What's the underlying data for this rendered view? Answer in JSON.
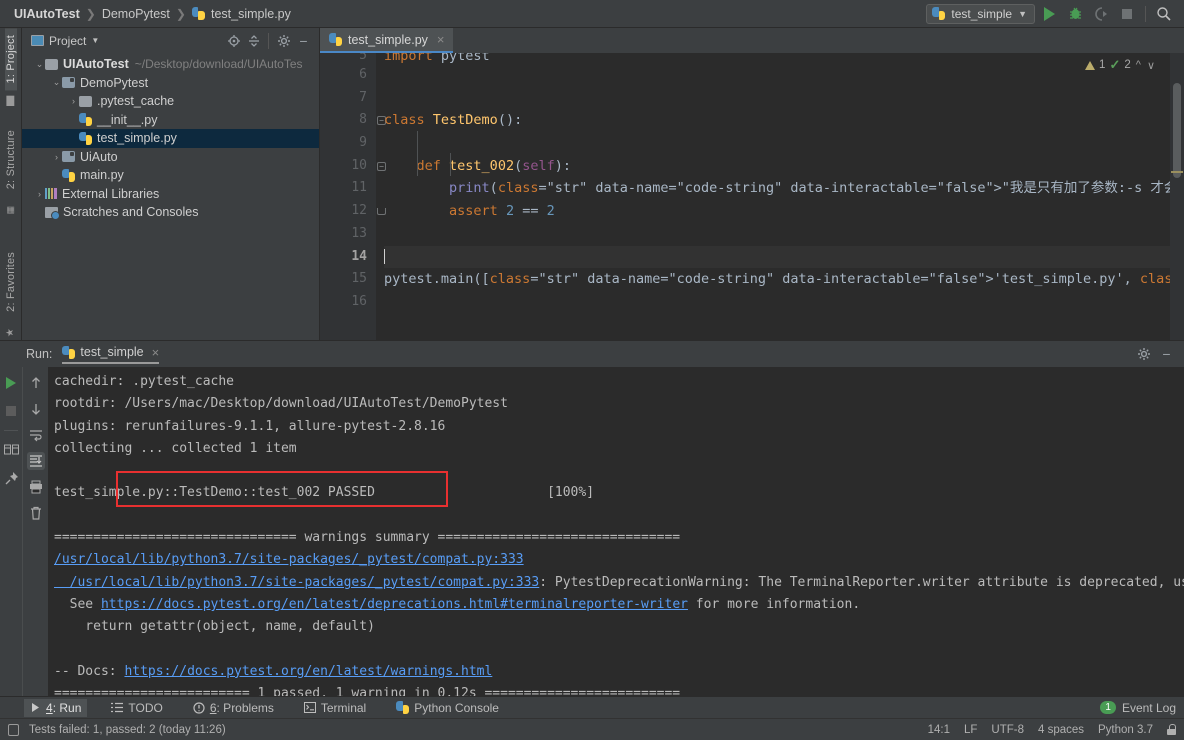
{
  "topbar": {
    "breadcrumbs": [
      "UIAutoTest",
      "DemoPytest",
      "test_simple.py"
    ],
    "run_config": "test_simple",
    "icons": [
      "run-icon",
      "debug-icon",
      "coverage-icon",
      "stop-icon",
      "search-icon"
    ]
  },
  "left_strip": {
    "tabs": [
      "1: Project",
      "2: Structure"
    ],
    "bottom_tabs": [
      "2: Favorites"
    ]
  },
  "project_panel": {
    "title": "Project",
    "header_icons": [
      "locate-icon",
      "collapse-all-icon",
      "gear-icon",
      "minimize-icon"
    ],
    "tree": [
      {
        "label": "UIAutoTest",
        "path": "~/Desktop/download/UIAutoTes",
        "depth": 0,
        "arrow": "⌄",
        "kind": "folder",
        "bold": true,
        "selected": false
      },
      {
        "label": "DemoPytest",
        "path": "",
        "depth": 1,
        "arrow": "⌄",
        "kind": "module",
        "bold": false,
        "selected": false
      },
      {
        "label": ".pytest_cache",
        "path": "",
        "depth": 2,
        "arrow": "›",
        "kind": "folder",
        "bold": false,
        "selected": false
      },
      {
        "label": "__init__.py",
        "path": "",
        "depth": 2,
        "arrow": "",
        "kind": "python",
        "bold": false,
        "selected": false
      },
      {
        "label": "test_simple.py",
        "path": "",
        "depth": 2,
        "arrow": "",
        "kind": "python",
        "bold": false,
        "selected": true
      },
      {
        "label": "UiAuto",
        "path": "",
        "depth": 1,
        "arrow": "›",
        "kind": "module",
        "bold": false,
        "selected": false
      },
      {
        "label": "main.py",
        "path": "",
        "depth": 1,
        "arrow": "",
        "kind": "python",
        "bold": false,
        "selected": false
      },
      {
        "label": "External Libraries",
        "path": "",
        "depth": 0,
        "arrow": "›",
        "kind": "library",
        "bold": false,
        "selected": false
      },
      {
        "label": "Scratches and Consoles",
        "path": "",
        "depth": 0,
        "arrow": "",
        "kind": "scratch",
        "bold": false,
        "selected": false
      }
    ]
  },
  "editor": {
    "tab_label": "test_simple.py",
    "inspection": {
      "warning_count": "1",
      "ok_count": "2"
    },
    "first_line_number": 5,
    "current_line": 14,
    "lines": [
      {
        "n": 5,
        "text": "import pytest",
        "clipped": true
      },
      {
        "n": 6,
        "text": ""
      },
      {
        "n": 7,
        "text": ""
      },
      {
        "n": 8,
        "text": "class TestDemo():",
        "fold": "open"
      },
      {
        "n": 9,
        "text": ""
      },
      {
        "n": 10,
        "text": "    def test_002(self):",
        "fold": "open"
      },
      {
        "n": 11,
        "text": "        print(\"我是只有加了参数:-s 才会显示出来\")"
      },
      {
        "n": 12,
        "text": "        assert 2 == 2",
        "fold": "end"
      },
      {
        "n": 13,
        "text": ""
      },
      {
        "n": 14,
        "text": ""
      },
      {
        "n": 15,
        "text": "pytest.main(['test_simple.py', '-v'])"
      },
      {
        "n": 16,
        "text": ""
      }
    ]
  },
  "run_panel": {
    "label": "Run:",
    "tab": "test_simple",
    "header_icons": [
      "gear-icon",
      "minimize-icon"
    ],
    "toolbar_left": [
      "rerun-icon",
      "stop-icon",
      "layout-icon",
      "pin-icon"
    ],
    "toolbar_right": [
      "up-icon",
      "down-icon",
      "soft-wrap-icon",
      "scroll-to-end-icon",
      "print-icon",
      "clear-all-icon"
    ],
    "console": [
      {
        "segs": [
          {
            "t": "cachedir: .pytest_cache"
          }
        ]
      },
      {
        "segs": [
          {
            "t": "rootdir: /Users/mac/Desktop/download/UIAutoTest/DemoPytest"
          }
        ]
      },
      {
        "segs": [
          {
            "t": "plugins: rerunfailures-9.1.1, allure-pytest-2.8.16"
          }
        ]
      },
      {
        "segs": [
          {
            "t": "collecting ... collected 1 item"
          }
        ]
      },
      {
        "segs": [
          {
            "t": ""
          }
        ]
      },
      {
        "segs": [
          {
            "t": "test_simple.py::TestDemo::test_002 PASSED                      [100%]"
          }
        ]
      },
      {
        "segs": [
          {
            "t": ""
          }
        ]
      },
      {
        "segs": [
          {
            "t": "=============================== warnings summary ==============================="
          }
        ]
      },
      {
        "segs": [
          {
            "t": "/usr/local/lib/python3.7/site-packages/_pytest/compat.py:333",
            "link": true
          }
        ]
      },
      {
        "segs": [
          {
            "t": "  /usr/local/lib/python3.7/site-packages/_pytest/compat.py:333",
            "link": true
          },
          {
            "t": ": PytestDeprecationWarning: The TerminalReporter.writer attribute is deprecated, use Te"
          }
        ]
      },
      {
        "segs": [
          {
            "t": "  See "
          },
          {
            "t": "https://docs.pytest.org/en/latest/deprecations.html#terminalreporter-writer",
            "link": true
          },
          {
            "t": " for more information."
          }
        ]
      },
      {
        "segs": [
          {
            "t": "    return getattr(object, name, default)"
          }
        ]
      },
      {
        "segs": [
          {
            "t": ""
          }
        ]
      },
      {
        "segs": [
          {
            "t": "-- Docs: "
          },
          {
            "t": "https://docs.pytest.org/en/latest/warnings.html",
            "link": true
          }
        ]
      },
      {
        "segs": [
          {
            "t": "========================= 1 passed, 1 warning in 0.12s ========================="
          }
        ]
      }
    ],
    "annotation_box_color": "#e83030"
  },
  "bottom_toolbar": {
    "items": [
      {
        "label": "4: Run",
        "underline_char": "4",
        "icon": "run-icon",
        "active": true
      },
      {
        "label": "TODO",
        "icon": "todo-icon",
        "active": false
      },
      {
        "label": "6: Problems",
        "underline_char": "6",
        "icon": "problems-icon",
        "active": false
      },
      {
        "label": "Terminal",
        "icon": "terminal-icon",
        "active": false
      },
      {
        "label": "Python Console",
        "icon": "python-icon",
        "active": false
      }
    ],
    "event_log": {
      "label": "Event Log",
      "count": "1"
    }
  },
  "statusbar": {
    "message": "Tests failed: 1, passed: 2 (today 11:26)",
    "caret": "14:1",
    "line_sep": "LF",
    "encoding": "UTF-8",
    "indent": "4 spaces",
    "interpreter": "Python 3.7"
  }
}
